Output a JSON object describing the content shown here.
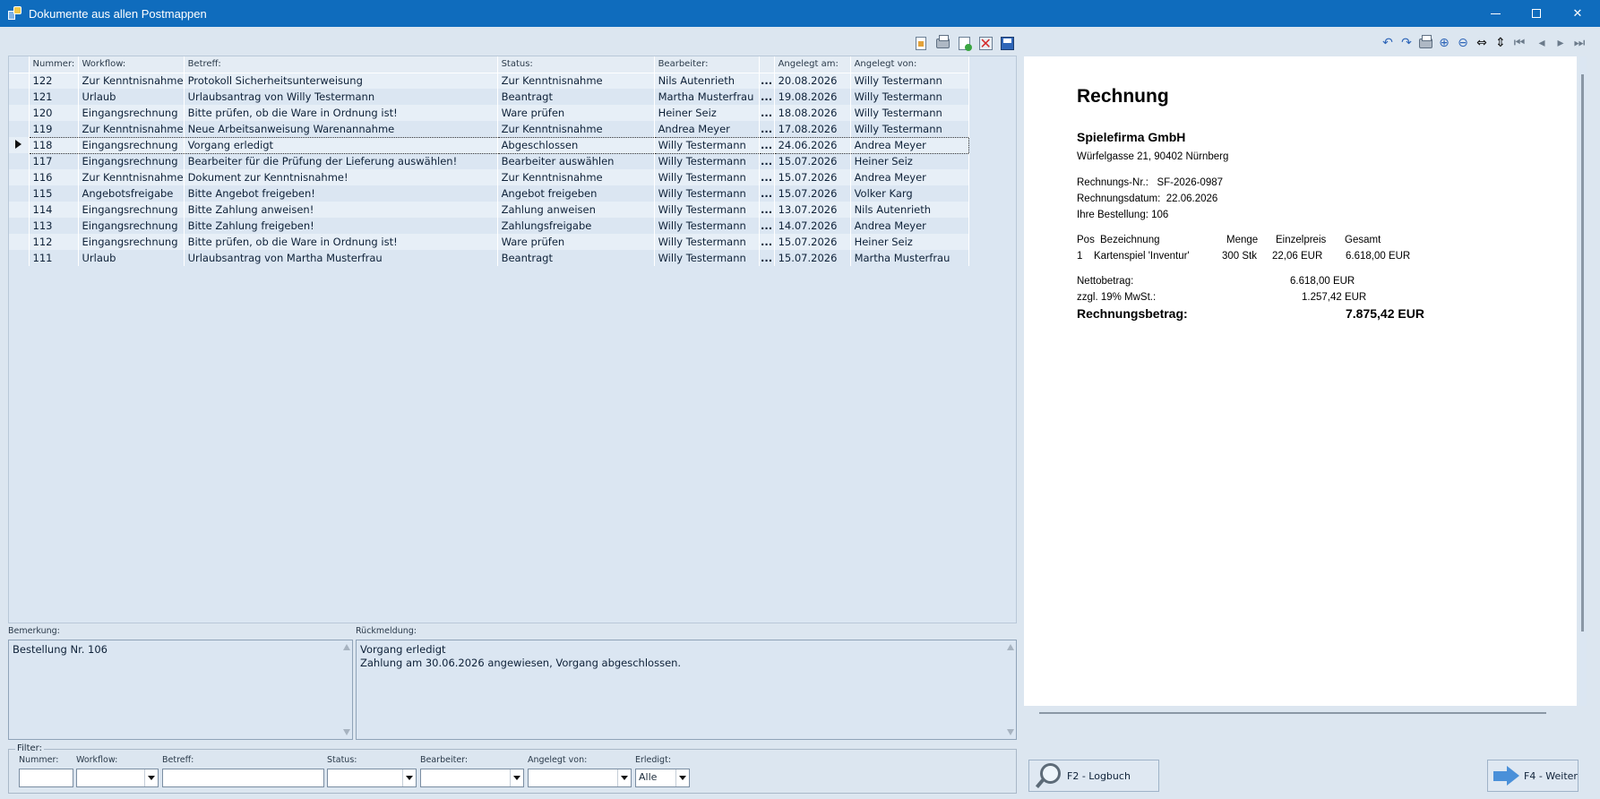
{
  "window": {
    "title": "Dokumente aus allen Postmappen"
  },
  "grid": {
    "columns": [
      "Nummer:",
      "Workflow:",
      "Betreff:",
      "Status:",
      "Bearbeiter:",
      "",
      "Angelegt am:",
      "Angelegt von:"
    ],
    "rows": [
      [
        "122",
        "Zur Kenntnisnahme",
        "Protokoll Sicherheitsunterweisung",
        "Zur Kenntnisnahme",
        "Nils Autenrieth",
        "...",
        "20.08.2026",
        "Willy Testermann"
      ],
      [
        "121",
        "Urlaub",
        "Urlaubsantrag von Willy Testermann",
        "Beantragt",
        "Martha Musterfrau",
        "...",
        "19.08.2026",
        "Willy Testermann"
      ],
      [
        "120",
        "Eingangsrechnung",
        "Bitte prüfen, ob die Ware in Ordnung ist!",
        "Ware prüfen",
        "Heiner Seiz",
        "...",
        "18.08.2026",
        "Willy Testermann"
      ],
      [
        "119",
        "Zur Kenntnisnahme",
        "Neue Arbeitsanweisung Warenannahme",
        "Zur Kenntnisnahme",
        "Andrea Meyer",
        "...",
        "17.08.2026",
        "Willy Testermann"
      ],
      [
        "118",
        "Eingangsrechnung",
        "Vorgang erledigt",
        "Abgeschlossen",
        "Willy Testermann",
        "...",
        "24.06.2026",
        "Andrea Meyer"
      ],
      [
        "117",
        "Eingangsrechnung",
        "Bearbeiter für die Prüfung der Lieferung auswählen!",
        "Bearbeiter auswählen",
        "Willy Testermann",
        "...",
        "15.07.2026",
        "Heiner Seiz"
      ],
      [
        "116",
        "Zur Kenntnisnahme",
        "Dokument zur Kenntnisnahme!",
        "Zur Kenntnisnahme",
        "Willy Testermann",
        "...",
        "15.07.2026",
        "Andrea Meyer"
      ],
      [
        "115",
        "Angebotsfreigabe",
        "Bitte Angebot freigeben!",
        "Angebot freigeben",
        "Willy Testermann",
        "...",
        "15.07.2026",
        "Volker Karg"
      ],
      [
        "114",
        "Eingangsrechnung",
        "Bitte Zahlung anweisen!",
        "Zahlung anweisen",
        "Willy Testermann",
        "...",
        "13.07.2026",
        "Nils Autenrieth"
      ],
      [
        "113",
        "Eingangsrechnung",
        "Bitte Zahlung freigeben!",
        "Zahlungsfreigabe",
        "Willy Testermann",
        "...",
        "14.07.2026",
        "Andrea Meyer"
      ],
      [
        "112",
        "Eingangsrechnung",
        "Bitte prüfen, ob die Ware in Ordnung ist!",
        "Ware prüfen",
        "Willy Testermann",
        "...",
        "15.07.2026",
        "Heiner Seiz"
      ],
      [
        "111",
        "Urlaub",
        "Urlaubsantrag von Martha Musterfrau",
        "Beantragt",
        "Willy Testermann",
        "...",
        "15.07.2026",
        "Martha Musterfrau"
      ]
    ],
    "selected_index": 4
  },
  "bemerkung": {
    "label": "Bemerkung:",
    "lines": [
      "Bestellung Nr. 106"
    ]
  },
  "rueckmeldung": {
    "label": "Rückmeldung:",
    "lines": [
      "Vorgang erledigt",
      "",
      "Zahlung am 30.06.2026 angewiesen, Vorgang abgeschlossen."
    ]
  },
  "filter": {
    "title": "Filter:",
    "nummer_label": "Nummer:",
    "workflow_label": "Workflow:",
    "betreff_label": "Betreff:",
    "status_label": "Status:",
    "bearbeiter_label": "Bearbeiter:",
    "angelegt_von_label": "Angelegt von:",
    "erledigt_label": "Erledigt:",
    "erledigt_value": "Alle"
  },
  "preview": {
    "heading": "Rechnung",
    "company": "Spielefirma GmbH",
    "address": "Würfelgasse 21, 90402 Nürnberg",
    "invoice_no": "Rechnungs-Nr.:   SF-2026-0987",
    "invoice_date": "Rechnungsdatum:  22.06.2026",
    "order": "Ihre Bestellung: 106",
    "table_header": {
      "pos": "Pos",
      "bezeichnung": "Bezeichnung",
      "menge": "Menge",
      "einzelpreis": "Einzelpreis",
      "gesamt": "Gesamt"
    },
    "table_row": {
      "pos": "1",
      "bezeichnung": "Kartenspiel 'Inventur'",
      "menge": "300 Stk",
      "einzelpreis": "22,06 EUR",
      "gesamt": "6.618,00 EUR"
    },
    "netto_label": "Nettobetrag:",
    "netto_value": "6.618,00 EUR",
    "mwst_label": "zzgl. 19% MwSt.:",
    "mwst_value": "1.257,42 EUR",
    "total_label": "Rechnungsbetrag:",
    "total_value": "7.875,42 EUR"
  },
  "buttons": {
    "logbuch": "F2 - Logbuch",
    "weiter": "F4 - Weiter"
  },
  "icons": {
    "left_toolbar": [
      "new-document-icon",
      "print-icon",
      "export-icon",
      "delete-icon",
      "save-icon"
    ],
    "right_toolbar": [
      "undo-icon",
      "redo-icon",
      "print-icon",
      "zoom-in-icon",
      "zoom-out-icon",
      "fit-width-icon",
      "fit-page-icon",
      "first-page-icon",
      "prev-page-icon",
      "next-page-icon",
      "last-page-icon"
    ]
  },
  "colors": {
    "titlebar": "#0f6cbd",
    "panel": "#dbe6f2",
    "row_alt": "#e7eff7"
  }
}
